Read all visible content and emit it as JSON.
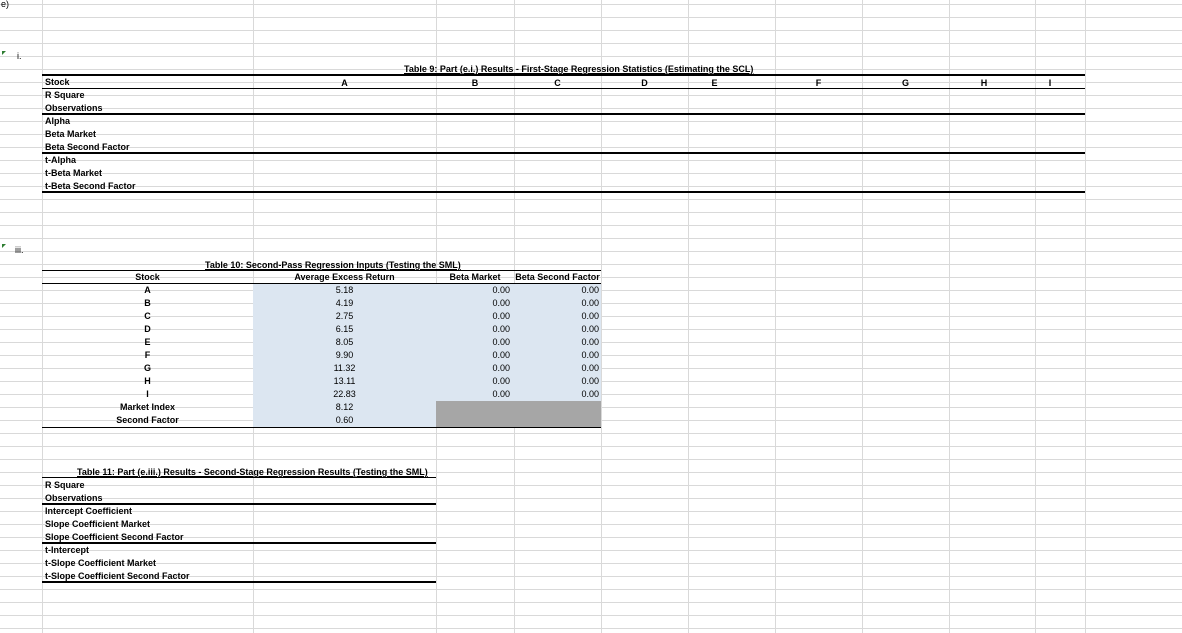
{
  "labels": {
    "part": "e)",
    "sub_i": "i.",
    "sub_iii": "iii."
  },
  "table9": {
    "title": "Table 9: Part (e.i.) Results - First-Stage Regression Statistics (Estimating the SCL)",
    "corner": "Stock",
    "columns": [
      "A",
      "B",
      "C",
      "D",
      "E",
      "F",
      "G",
      "H",
      "I"
    ],
    "rows": [
      "R Square",
      "Observations",
      "Alpha",
      "Beta Market",
      "Beta Second Factor",
      "t-Alpha",
      "t-Beta Market",
      "t-Beta Second Factor"
    ]
  },
  "table10": {
    "title": "Table 10: Second-Pass Regression Inputs (Testing the SML)",
    "headers": {
      "stock": "Stock",
      "avg": "Average Excess Return",
      "beta_m": "Beta Market",
      "beta_s": "Beta Second Factor"
    },
    "rows": [
      {
        "stock": "A",
        "avg": "5.18",
        "beta_m": "0.00",
        "beta_s": "0.00"
      },
      {
        "stock": "B",
        "avg": "4.19",
        "beta_m": "0.00",
        "beta_s": "0.00"
      },
      {
        "stock": "C",
        "avg": "2.75",
        "beta_m": "0.00",
        "beta_s": "0.00"
      },
      {
        "stock": "D",
        "avg": "6.15",
        "beta_m": "0.00",
        "beta_s": "0.00"
      },
      {
        "stock": "E",
        "avg": "8.05",
        "beta_m": "0.00",
        "beta_s": "0.00"
      },
      {
        "stock": "F",
        "avg": "9.90",
        "beta_m": "0.00",
        "beta_s": "0.00"
      },
      {
        "stock": "G",
        "avg": "11.32",
        "beta_m": "0.00",
        "beta_s": "0.00"
      },
      {
        "stock": "H",
        "avg": "13.11",
        "beta_m": "0.00",
        "beta_s": "0.00"
      },
      {
        "stock": "I",
        "avg": "22.83",
        "beta_m": "0.00",
        "beta_s": "0.00"
      },
      {
        "stock": "Market Index",
        "avg": "8.12",
        "beta_m": "",
        "beta_s": ""
      },
      {
        "stock": "Second Factor",
        "avg": "0.60",
        "beta_m": "",
        "beta_s": ""
      }
    ]
  },
  "table11": {
    "title": "Table 11: Part (e.iii.) Results - Second-Stage Regression Results (Testing the SML)",
    "rows": [
      "R Square",
      "Observations",
      "Intercept Coefficient",
      "Slope Coefficient Market",
      "Slope Coefficient Second Factor",
      "t-Intercept",
      "t-Slope Coefficient Market",
      "t-Slope Coefficient Second Factor"
    ]
  }
}
